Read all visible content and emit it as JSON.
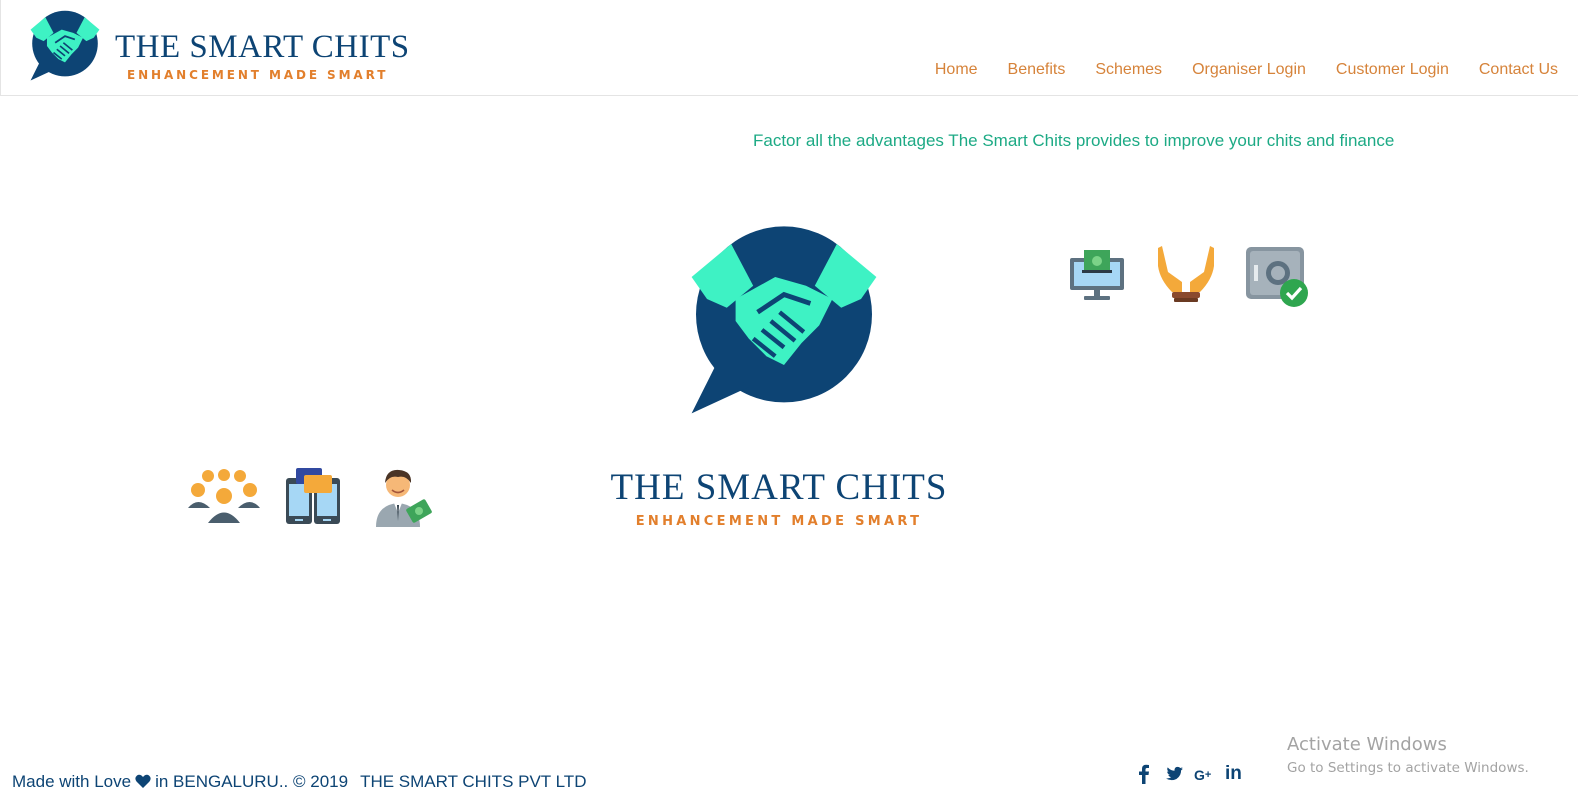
{
  "header": {
    "brand_name": "THE SMART CHITS",
    "brand_tagline": "ENHANCEMENT MADE SMART",
    "nav": [
      "Home",
      "Benefits",
      "Schemes",
      "Organiser Login",
      "Customer Login",
      "Contact Us"
    ]
  },
  "main": {
    "tagline": "Factor all the advantages The Smart Chits provides to improve your chits and finance",
    "hero": {
      "brand_name": "THE SMART CHITS",
      "brand_tagline": "ENHANCEMENT MADE SMART"
    },
    "icons": [
      "group-people-icon",
      "mobile-chat-icon",
      "businessman-cash-icon",
      "computer-money-icon",
      "helping-hands-icon",
      "safe-lock-check-icon"
    ]
  },
  "footer": {
    "made_with": "Made with Love",
    "location": "in BENGALURU.. © 2019",
    "company": "THE SMART CHITS PVT LTD",
    "social": [
      "facebook-icon",
      "twitter-icon",
      "google-plus-icon",
      "linkedin-icon"
    ]
  },
  "watermark": {
    "title": "Activate Windows",
    "subtitle": "Go to Settings to activate Windows."
  },
  "colors": {
    "navy": "#0d4474",
    "mint": "#3ef2c4",
    "orange": "#e27f2c",
    "nav_text": "#d6833a",
    "tagline_green": "#1daa85"
  }
}
